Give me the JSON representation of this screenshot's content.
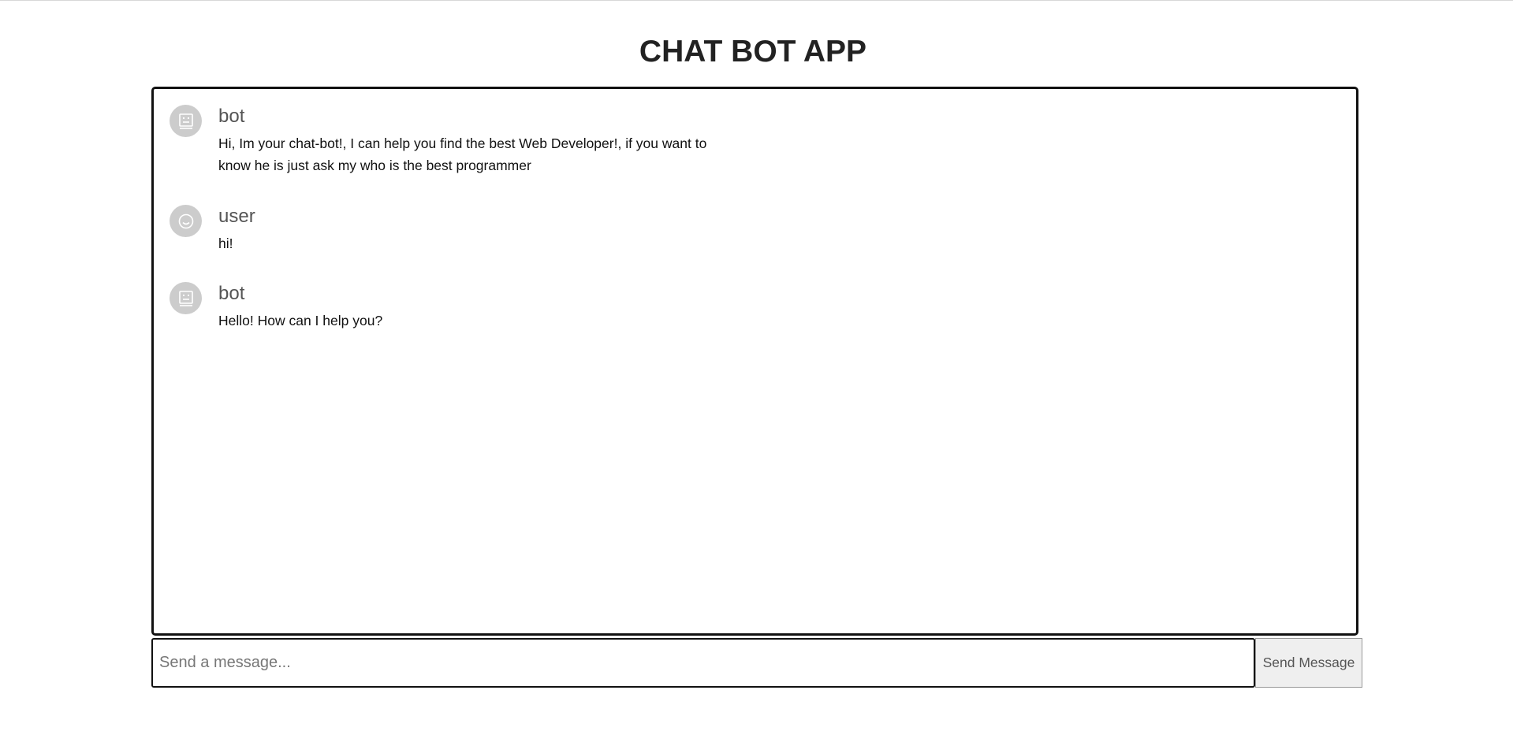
{
  "page": {
    "title": "CHAT BOT APP"
  },
  "chat": {
    "messages": [
      {
        "sender": "bot",
        "icon": "robot-icon",
        "text": "Hi, Im your chat-bot!, I can help you find the best Web Developer!, if you want to know he is just ask my who is the best programmer"
      },
      {
        "sender": "user",
        "icon": "smiley-icon",
        "text": "hi!"
      },
      {
        "sender": "bot",
        "icon": "robot-icon",
        "text": "Hello! How can I help you?"
      }
    ]
  },
  "composer": {
    "placeholder": "Send a message...",
    "value": "",
    "send_label": "Send Message"
  },
  "colors": {
    "avatar_bg": "#cccccc",
    "border": "#111111",
    "button_bg": "#efefef"
  }
}
